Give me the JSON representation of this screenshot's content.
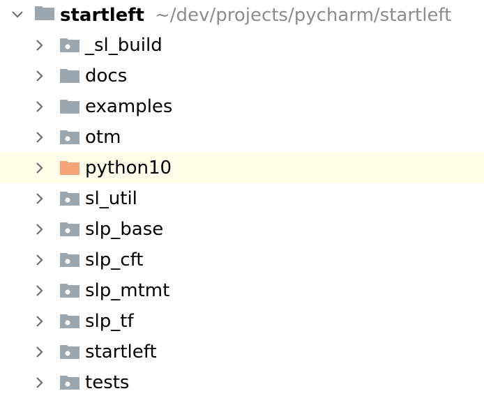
{
  "tree": {
    "root": {
      "name": "startleft",
      "path": "~/dev/projects/pycharm/startleft",
      "expanded": true
    },
    "children": [
      {
        "label": "_sl_build",
        "icon": "package-folder-icon"
      },
      {
        "label": "docs",
        "icon": "folder-icon"
      },
      {
        "label": "examples",
        "icon": "folder-icon"
      },
      {
        "label": "otm",
        "icon": "package-folder-icon"
      },
      {
        "label": "python10",
        "icon": "excluded-folder-icon",
        "highlighted": true
      },
      {
        "label": "sl_util",
        "icon": "package-folder-icon"
      },
      {
        "label": "slp_base",
        "icon": "package-folder-icon"
      },
      {
        "label": "slp_cft",
        "icon": "package-folder-icon"
      },
      {
        "label": "slp_mtmt",
        "icon": "package-folder-icon"
      },
      {
        "label": "slp_tf",
        "icon": "package-folder-icon"
      },
      {
        "label": "startleft",
        "icon": "package-folder-icon"
      },
      {
        "label": "tests",
        "icon": "package-folder-icon"
      }
    ]
  },
  "colors": {
    "folder": "#9aa7b0",
    "excluded_folder": "#f4a57a",
    "highlight_row": "#fefde7",
    "path_text": "#8c8c8c",
    "chevron": "#6e6e6e"
  }
}
